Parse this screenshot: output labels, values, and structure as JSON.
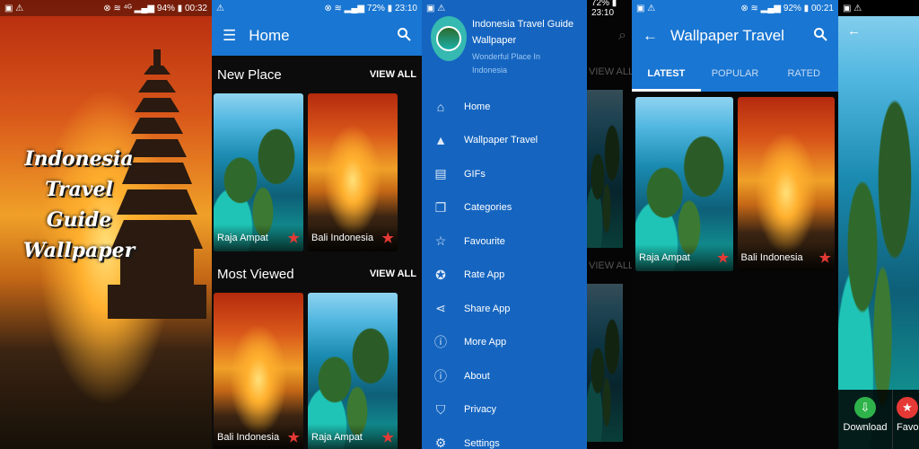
{
  "splash": {
    "status": {
      "left": "▣ ⚠",
      "right": "⊗ ≋ ⁴ᴳ ▂▄▆ 94% ▮ 00:32"
    },
    "title_lines": [
      "Indonesia",
      "Travel Guide",
      "Wallpaper"
    ]
  },
  "home": {
    "status": {
      "left": "⚠",
      "right": "⊗ ≋ ▂▄▆ 72% ▮ 23:10"
    },
    "title": "Home",
    "sections": [
      {
        "title": "New Place",
        "view_all": "VIEW ALL",
        "cards": [
          "Raja Ampat",
          "Bali Indonesia"
        ]
      },
      {
        "title": "Most Viewed",
        "view_all": "VIEW ALL",
        "cards": [
          "Bali Indonesia",
          "Raja Ampat"
        ]
      }
    ]
  },
  "drawer": {
    "status": {
      "left": "▣ ⚠",
      "right": "72% ▮ 23:10"
    },
    "app_name_1": "Indonesia Travel Guide",
    "app_name_2": "Wallpaper",
    "tagline_1": "Wonderful Place In",
    "tagline_2": "Indonesia",
    "behind_view_all_1": "VIEW ALL",
    "behind_view_all_2": "VIEW ALL",
    "items": [
      {
        "label": "Home",
        "icon": "home-icon",
        "glyph": "⌂"
      },
      {
        "label": "Wallpaper Travel",
        "icon": "image-icon",
        "glyph": "▲"
      },
      {
        "label": "GIFs",
        "icon": "gif-icon",
        "glyph": "▤"
      },
      {
        "label": "Categories",
        "icon": "folder-icon",
        "glyph": "❐"
      },
      {
        "label": "Favourite",
        "icon": "star-icon",
        "glyph": "☆"
      },
      {
        "label": "Rate App",
        "icon": "rate-icon",
        "glyph": "✪"
      },
      {
        "label": "Share App",
        "icon": "share-icon",
        "glyph": "⋖"
      },
      {
        "label": "More App",
        "icon": "info-icon",
        "glyph": "ⓘ"
      },
      {
        "label": "About",
        "icon": "about-icon",
        "glyph": "ⓘ"
      },
      {
        "label": "Privacy",
        "icon": "privacy-icon",
        "glyph": "⛉"
      },
      {
        "label": "Settings",
        "icon": "settings-icon",
        "glyph": "⚙"
      }
    ]
  },
  "wallpaper": {
    "status": {
      "left": "▣ ⚠",
      "right": "⊗ ≋ ▂▄▆ 92% ▮ 00:21"
    },
    "title": "Wallpaper Travel",
    "tabs": [
      "LATEST",
      "POPULAR",
      "RATED"
    ],
    "cards": [
      "Raja Ampat",
      "Bali Indonesia"
    ]
  },
  "viewer": {
    "status": {
      "left": "▣ ⚠"
    },
    "download": "Download",
    "favourite": "Favou"
  },
  "colors": {
    "primary": "#1976d2",
    "drawer": "#1565c0",
    "accent_star": "#e53935",
    "download": "#2eb34a"
  }
}
